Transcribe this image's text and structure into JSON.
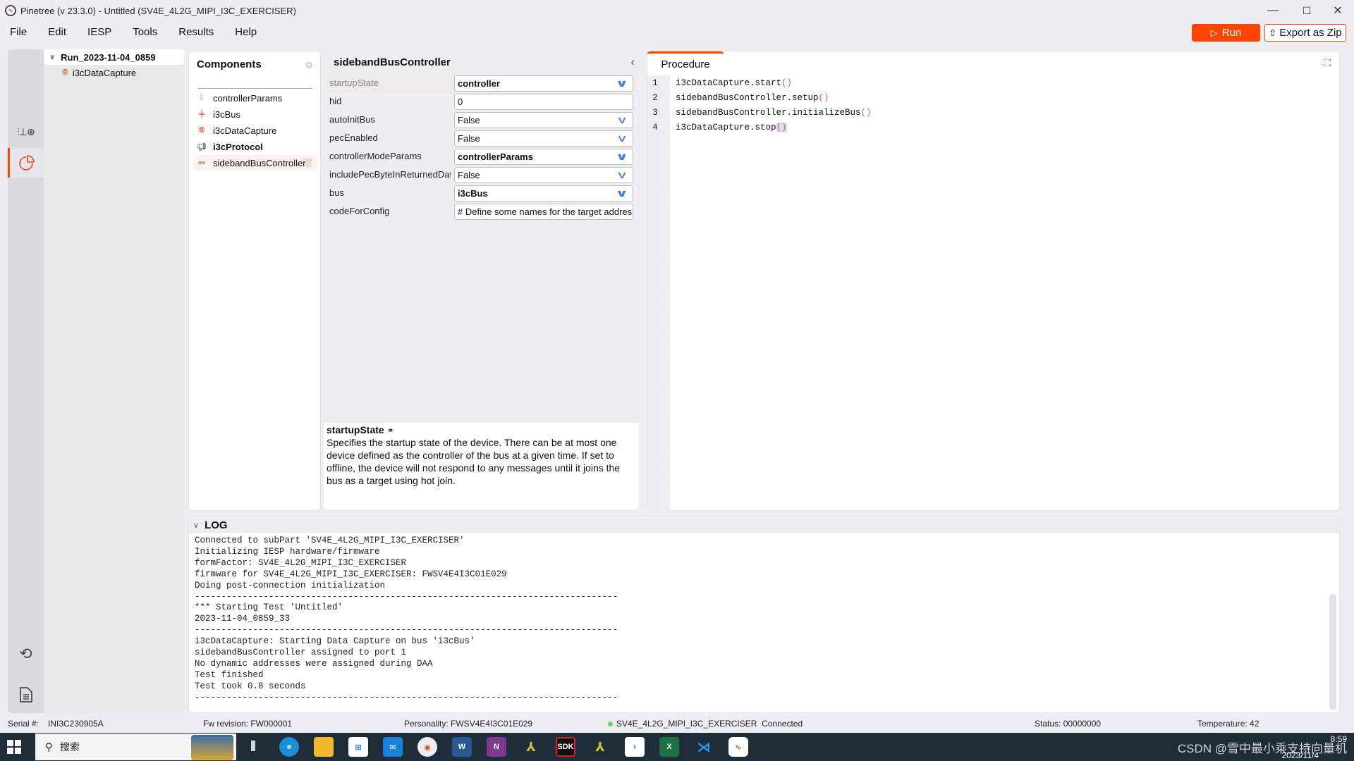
{
  "window": {
    "title": "Pinetree (v 23.3.0) - Untitled (SV4E_4L2G_MIPI_I3C_EXERCISER)",
    "controls": {
      "minimize": "—",
      "maximize": "☐",
      "close": "✕"
    }
  },
  "menu": [
    "File",
    "Edit",
    "IESP",
    "Tools",
    "Results",
    "Help"
  ],
  "toolbar": {
    "run_label": "Run",
    "export_label": "Export as Zip"
  },
  "tree": {
    "root": "Run_2023-11-04_0859",
    "children": [
      "i3cDataCapture"
    ]
  },
  "components": {
    "title": "Components",
    "items": [
      {
        "label": "controllerParams",
        "icon": "sliders-icon"
      },
      {
        "label": "i3cBus",
        "icon": "bus-icon"
      },
      {
        "label": "i3cDataCapture",
        "icon": "capture-icon"
      },
      {
        "label": "i3cProtocol",
        "icon": "megaphone-icon"
      },
      {
        "label": "sidebandBusController",
        "icon": "controller-icon"
      }
    ],
    "selected": "sidebandBusController"
  },
  "properties": {
    "title": "sidebandBusController",
    "rows": [
      {
        "label": "startupState",
        "value": "controller",
        "dropdown": true,
        "bold": true
      },
      {
        "label": "hid",
        "value": "0",
        "dropdown": false,
        "bold": false
      },
      {
        "label": "autoInitBus",
        "value": "False",
        "dropdown": true,
        "bold": false
      },
      {
        "label": "pecEnabled",
        "value": "False",
        "dropdown": true,
        "bold": false
      },
      {
        "label": "controllerModeParams",
        "value": "controllerParams",
        "dropdown": true,
        "bold": true
      },
      {
        "label": "includePecByteInReturnedDat",
        "value": "False",
        "dropdown": true,
        "bold": false
      },
      {
        "label": "bus",
        "value": "i3cBus",
        "dropdown": true,
        "bold": true
      },
      {
        "label": "codeForConfig",
        "value": "# Define some names for the target address",
        "dropdown": false,
        "bold": false
      }
    ],
    "description": {
      "title": "startupState",
      "body": "Specifies the startup state of the device. There can be at most one device defined as the controller of the bus at a given time. If set to offline, the device will not respond to any messages until it joins the bus as a target using hot join."
    }
  },
  "procedure": {
    "tab": "Procedure",
    "lines": [
      {
        "n": "1",
        "code": "i3cDataCapture.start"
      },
      {
        "n": "2",
        "code": "sidebandBusController.setup"
      },
      {
        "n": "3",
        "code": "sidebandBusController.initializeBus"
      },
      {
        "n": "4",
        "code": "i3cDataCapture.stop"
      }
    ],
    "parens": "()"
  },
  "log": {
    "title": "LOG",
    "lines": [
      "Connected to subPart 'SV4E_4L2G_MIPI_I3C_EXERCISER'",
      "Initializing IESP hardware/firmware",
      "formFactor: SV4E_4L2G_MIPI_I3C_EXERCISER",
      "firmware for SV4E_4L2G_MIPI_I3C_EXERCISER: FWSV4E4I3C01E029",
      "Doing post-connection initialization",
      "--------------------------------------------------------------------------------",
      "*** Starting Test 'Untitled'",
      "2023-11-04_0859_33",
      "--------------------------------------------------------------------------------",
      "i3cDataCapture: Starting Data Capture on bus 'i3cBus'",
      "sidebandBusController assigned to port 1",
      "No dynamic addresses were assigned during DAA",
      "Test finished",
      "Test took 0.8 seconds",
      "--------------------------------------------------------------------------------"
    ]
  },
  "status": {
    "serial_label": "Serial #:",
    "serial": "INI3C230905A",
    "fw_revision": "Fw revision: FW000001",
    "personality": "Personality: FWSV4E4I3C01E029",
    "connection": "SV4E_4L2G_MIPI_I3C_EXERCISER  Connected",
    "status": "Status: 00000000",
    "temperature": "Temperature: 42"
  },
  "taskbar": {
    "search_placeholder": "搜索",
    "clock_time": "8:59",
    "clock_date": "2023/11/4",
    "watermark": "CSDN @雪中最小乘支持向量机"
  },
  "colors": {
    "accent": "#ff4500",
    "link_blue": "#3c7be0",
    "connected": "#6cd06c"
  }
}
